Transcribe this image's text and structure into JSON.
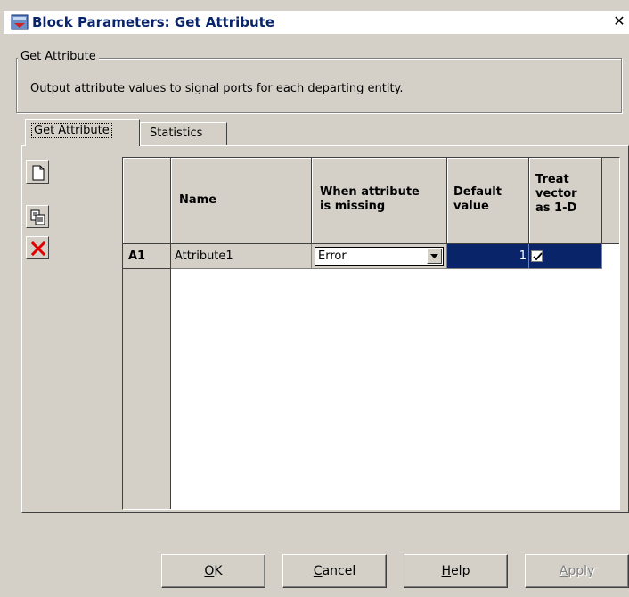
{
  "window": {
    "title": "Block Parameters: Get Attribute",
    "close_glyph": "✕"
  },
  "group": {
    "legend": "Get Attribute",
    "description": "Output attribute values to signal ports for each departing entity."
  },
  "tabs": [
    {
      "label": "Get Attribute",
      "active": true
    },
    {
      "label": "Statistics",
      "active": false
    }
  ],
  "toolbar": {
    "buttons": [
      {
        "icon": "new-row-icon"
      },
      {
        "icon": "copy-row-icon"
      },
      {
        "icon": "delete-row-icon"
      }
    ]
  },
  "table": {
    "headers": {
      "name": "Name",
      "missing_line1": "When attribute",
      "missing_line2": "is missing",
      "default_line1": "Default",
      "default_line2": "value",
      "treat_line1": "Treat",
      "treat_line2": "vector",
      "treat_line3": "as 1-D"
    },
    "rows": [
      {
        "id": "A1",
        "name": "Attribute1",
        "when_missing": "Error",
        "default_value": "1",
        "treat_as_1d": true
      }
    ]
  },
  "buttons": {
    "ok": {
      "u": "O",
      "rest": "K"
    },
    "cancel": {
      "u": "C",
      "rest": "ancel"
    },
    "help": {
      "u": "H",
      "rest": "elp"
    },
    "apply": {
      "u": "A",
      "rest": "pply",
      "disabled": true
    }
  },
  "colors": {
    "selection": "#0a246a",
    "face": "#d4d0c8",
    "delete_red": "#e00000"
  }
}
